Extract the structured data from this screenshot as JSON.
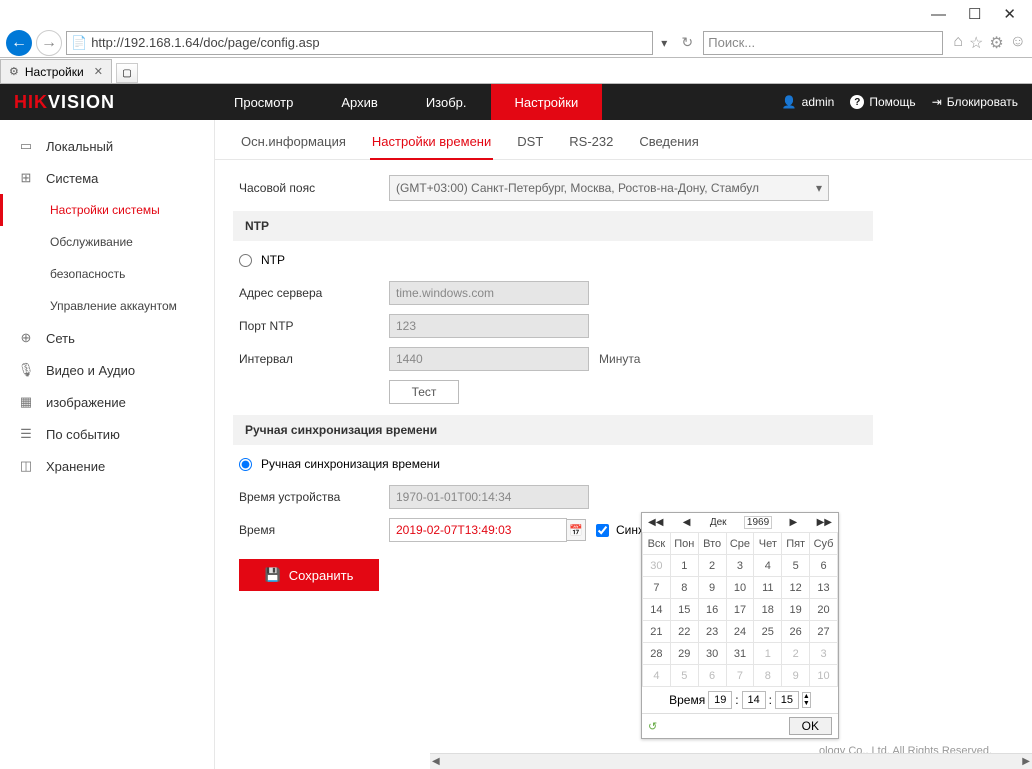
{
  "browser": {
    "url": "http://192.168.1.64/doc/page/config.asp",
    "search_placeholder": "Поиск...",
    "tab_title": "Настройки"
  },
  "header": {
    "logo_prefix": "HIK",
    "logo_suffix": "VISION",
    "nav": [
      "Просмотр",
      "Архив",
      "Изобр.",
      "Настройки"
    ],
    "active_nav": "Настройки",
    "user": "admin",
    "help": "Помощь",
    "logout": "Блокировать"
  },
  "sidebar": {
    "items": [
      {
        "label": "Локальный",
        "icon": "▭"
      },
      {
        "label": "Система",
        "icon": "⊞",
        "children": [
          {
            "label": "Настройки системы",
            "active": true
          },
          {
            "label": "Обслуживание"
          },
          {
            "label": "безопасность"
          },
          {
            "label": "Управление аккаунтом"
          }
        ]
      },
      {
        "label": "Сеть",
        "icon": "⊕"
      },
      {
        "label": "Видео и Аудио",
        "icon": "🎙"
      },
      {
        "label": "изображение",
        "icon": "▦"
      },
      {
        "label": "По событию",
        "icon": "☰"
      },
      {
        "label": "Хранение",
        "icon": "◫"
      }
    ]
  },
  "subtabs": [
    "Осн.информация",
    "Настройки времени",
    "DST",
    "RS-232",
    "Сведения"
  ],
  "active_subtab": "Настройки времени",
  "form": {
    "tz_label": "Часовой пояс",
    "tz_value": "(GMT+03:00) Санкт-Петербург, Москва, Ростов-на-Дону, Стамбул",
    "section_ntp": "NTP",
    "radio_ntp": "NTP",
    "server_label": "Адрес сервера",
    "server_value": "time.windows.com",
    "port_label": "Порт NTP",
    "port_value": "123",
    "interval_label": "Интервал",
    "interval_value": "1440",
    "interval_unit": "Минута",
    "test": "Тест",
    "section_manual": "Ручная синхронизация времени",
    "radio_manual": "Ручная синхронизация времени",
    "device_time_label": "Время устройства",
    "device_time_value": "1970-01-01T00:14:34",
    "set_time_label": "Время",
    "set_time_value": "2019-02-07T13:49:03",
    "sync_pc": "Синхронизировать со временем ПК",
    "save": "Сохранить"
  },
  "datepicker": {
    "month": "Дек",
    "year": "1969",
    "dow": [
      "Вск",
      "Пон",
      "Вто",
      "Сре",
      "Чет",
      "Пят",
      "Суб"
    ],
    "weeks": [
      [
        {
          "d": "30",
          "m": 1
        },
        {
          "d": "1",
          "m": 0
        },
        {
          "d": "2",
          "m": 0
        },
        {
          "d": "3",
          "m": 0
        },
        {
          "d": "4",
          "m": 0
        },
        {
          "d": "5",
          "m": 0
        },
        {
          "d": "6",
          "m": 0
        }
      ],
      [
        {
          "d": "7",
          "m": 0
        },
        {
          "d": "8",
          "m": 0
        },
        {
          "d": "9",
          "m": 0
        },
        {
          "d": "10",
          "m": 0
        },
        {
          "d": "11",
          "m": 0
        },
        {
          "d": "12",
          "m": 0
        },
        {
          "d": "13",
          "m": 0
        }
      ],
      [
        {
          "d": "14",
          "m": 0
        },
        {
          "d": "15",
          "m": 0
        },
        {
          "d": "16",
          "m": 0
        },
        {
          "d": "17",
          "m": 0
        },
        {
          "d": "18",
          "m": 0
        },
        {
          "d": "19",
          "m": 0
        },
        {
          "d": "20",
          "m": 0
        }
      ],
      [
        {
          "d": "21",
          "m": 0
        },
        {
          "d": "22",
          "m": 0
        },
        {
          "d": "23",
          "m": 0
        },
        {
          "d": "24",
          "m": 0
        },
        {
          "d": "25",
          "m": 0
        },
        {
          "d": "26",
          "m": 0
        },
        {
          "d": "27",
          "m": 0
        }
      ],
      [
        {
          "d": "28",
          "m": 0
        },
        {
          "d": "29",
          "m": 0
        },
        {
          "d": "30",
          "m": 0
        },
        {
          "d": "31",
          "m": 0
        },
        {
          "d": "1",
          "m": 1
        },
        {
          "d": "2",
          "m": 1
        },
        {
          "d": "3",
          "m": 1
        }
      ],
      [
        {
          "d": "4",
          "m": 1
        },
        {
          "d": "5",
          "m": 1
        },
        {
          "d": "6",
          "m": 1
        },
        {
          "d": "7",
          "m": 1
        },
        {
          "d": "8",
          "m": 1
        },
        {
          "d": "9",
          "m": 1
        },
        {
          "d": "10",
          "m": 1
        }
      ]
    ],
    "time_label": "Время",
    "hh": "19",
    "mm": "14",
    "ss": "15",
    "ok": "OK"
  },
  "footer": "ology Co., Ltd. All Rights Reserved."
}
